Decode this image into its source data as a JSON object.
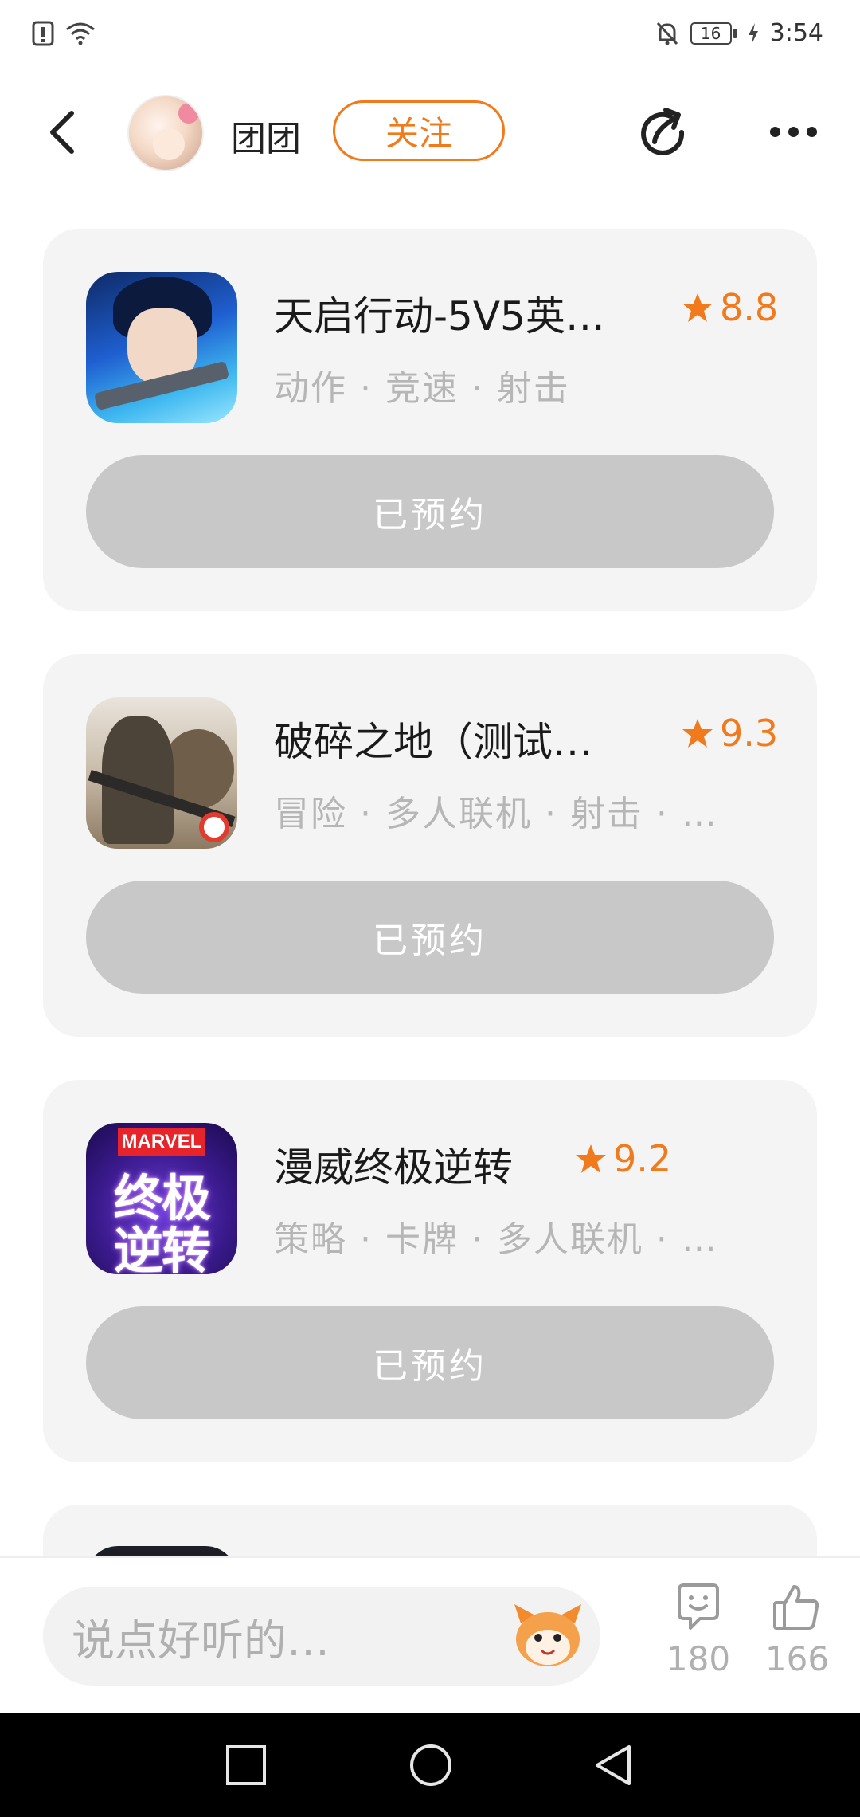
{
  "status_bar": {
    "battery": "16",
    "time": "3:54"
  },
  "header": {
    "username": "团团",
    "follow_label": "关注"
  },
  "games": [
    {
      "title": "天启行动-5V5英…",
      "rating": "8.8",
      "tags": "动作 · 竞速 · 射击",
      "button_label": "已预约"
    },
    {
      "title": "破碎之地（测试…",
      "rating": "9.3",
      "tags": "冒险 · 多人联机 · 射击 · …",
      "button_label": "已预约"
    },
    {
      "title": "漫威终极逆转",
      "rating": "9.2",
      "tags": "策略 · 卡牌 · 多人联机 · …",
      "button_label": "已预约",
      "icon_text": {
        "brand": "MARVEL",
        "line1": "终极",
        "line2": "逆转"
      }
    }
  ],
  "comment_bar": {
    "placeholder": "说点好听的…",
    "comment_count": "180",
    "like_count": "166"
  },
  "colors": {
    "accent": "#f07a1c",
    "card_bg": "#f4f4f4",
    "reserved_btn": "#c8c8c8",
    "tag_text": "#b6b6b6"
  },
  "icons": {
    "back": "chevron-left-icon",
    "share": "share-icon",
    "more": "more-dots-icon",
    "star": "star-icon",
    "comment": "comment-smile-icon",
    "like": "thumbs-up-icon"
  }
}
